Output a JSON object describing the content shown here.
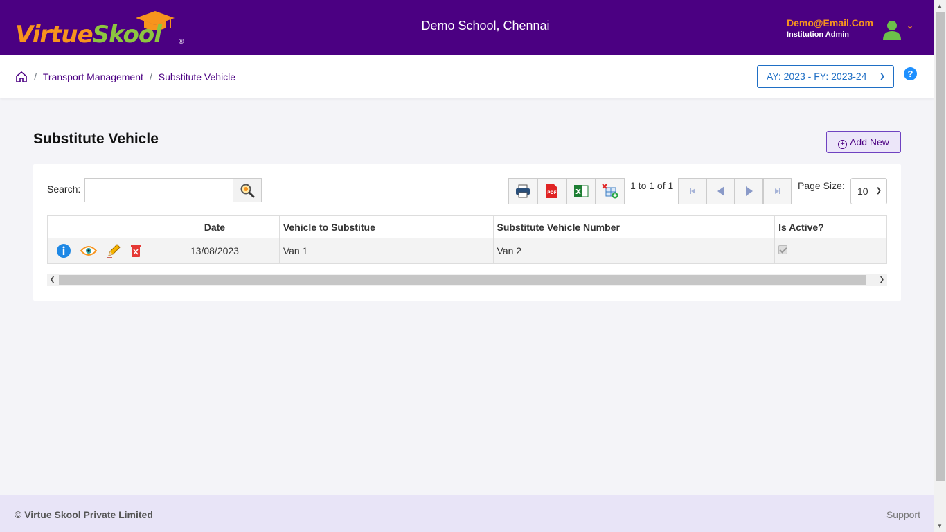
{
  "header": {
    "logo_part1": "Virtue",
    "logo_part2": "Skool",
    "logo_reg": "®",
    "school_name": "Demo School, Chennai",
    "user_email": "Demo@Email.Com",
    "user_role": "Institution Admin"
  },
  "breadcrumb": {
    "items": [
      "Transport Management",
      "Substitute Vehicle"
    ],
    "separator": "/"
  },
  "year_select": {
    "value": "AY: 2023 - FY: 2023-24"
  },
  "help": {
    "label": "?"
  },
  "page": {
    "title": "Substitute Vehicle",
    "add_new_label": "Add New"
  },
  "toolbar": {
    "search_label": "Search:",
    "search_value": "",
    "record_count": "1 to 1 of 1",
    "page_size_label": "Page Size:",
    "page_size": "10"
  },
  "table": {
    "columns": [
      "",
      "Date",
      "Vehicle to Substitue",
      "Substitute Vehicle Number",
      "Is Active?"
    ],
    "rows": [
      {
        "date": "13/08/2023",
        "vehicle": "Van 1",
        "substitute": "Van 2",
        "active": true
      }
    ]
  },
  "footer": {
    "copyright": "© Virtue Skool Private Limited",
    "support": "Support"
  },
  "colors": {
    "brand_purple": "#4b0082",
    "brand_orange": "#f7941d",
    "brand_green": "#8dc63f",
    "link_blue": "#1f6fc5"
  }
}
